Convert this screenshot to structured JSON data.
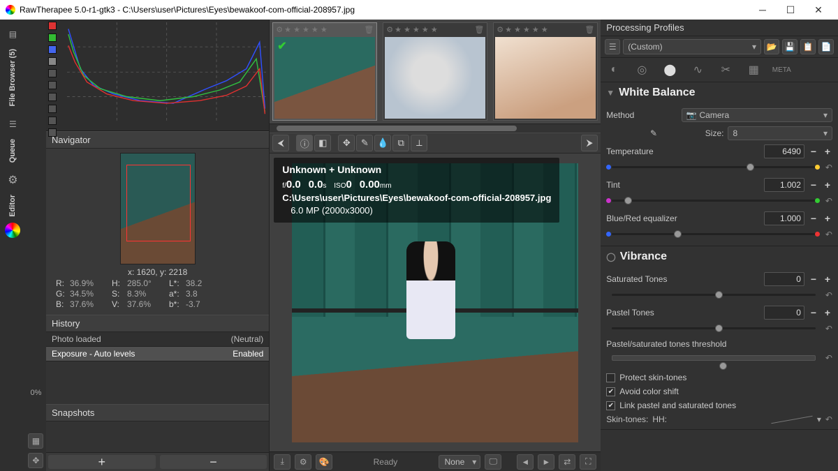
{
  "title": "RawTherapee 5.0-r1-gtk3 - C:\\Users\\user\\Pictures\\Eyes\\bewakoof-com-official-208957.jpg",
  "rail": {
    "file_browser": "File Browser (5)",
    "queue": "Queue",
    "editor": "Editor"
  },
  "zoom_pct": "0%",
  "navigator": {
    "title": "Navigator",
    "pos": "x: 1620, y: 2218",
    "R": "36.9%",
    "G": "34.5%",
    "B": "37.6%",
    "H": "285.0°",
    "S": "8.3%",
    "V": "37.6%",
    "Lstar": "38.2",
    "astar": "3.8",
    "bstar": "-3.7",
    "labR": "R:",
    "labG": "G:",
    "labB": "B:",
    "labH": "H:",
    "labS": "S:",
    "labV": "V:",
    "labL": "L*:",
    "laba": "a*:",
    "labb": "b*:"
  },
  "history": {
    "title": "History",
    "rows": [
      {
        "name": "Photo loaded",
        "state": "(Neutral)"
      },
      {
        "name": "Exposure - Auto levels",
        "state": "Enabled"
      }
    ]
  },
  "snapshots": {
    "title": "Snapshots"
  },
  "filmstrip": {
    "stars": "★ ★ ★ ★ ★"
  },
  "overlay": {
    "l1": "Unknown + Unknown",
    "l2_f": "f/",
    "l2_fv": "0.0",
    "l2_sh": "0.0",
    "l2_s": "s",
    "l2_iso": "ISO",
    "l2_isov": "0",
    "l2_fl": "0.00",
    "l2_mm": "mm",
    "l3": "C:\\Users\\user\\Pictures\\Eyes\\bewakoof-com-official-208957.jpg",
    "l4": "6.0 MP (2000x3000)"
  },
  "status": {
    "ready": "Ready",
    "none": "None"
  },
  "profiles": {
    "title": "Processing Profiles",
    "value": "(Custom)"
  },
  "wb": {
    "title": "White Balance",
    "method_lab": "Method",
    "method_val": "Camera",
    "size_lab": "Size:",
    "size_val": "8",
    "temp_lab": "Temperature",
    "temp_val": "6490",
    "tint_lab": "Tint",
    "tint_val": "1.002",
    "br_lab": "Blue/Red equalizer",
    "br_val": "1.000"
  },
  "vib": {
    "title": "Vibrance",
    "sat_lab": "Saturated Tones",
    "sat_val": "0",
    "pas_lab": "Pastel Tones",
    "pas_val": "0",
    "thr_lab": "Pastel/saturated tones threshold",
    "chk1": "Protect skin-tones",
    "chk2": "Avoid color shift",
    "chk3": "Link pastel and saturated tones",
    "skin_lab": "Skin-tones:",
    "skin_val": "HH:"
  },
  "glyph": {
    "minus": "−",
    "plus": "+",
    "caret": "▾",
    "check": "✔"
  }
}
